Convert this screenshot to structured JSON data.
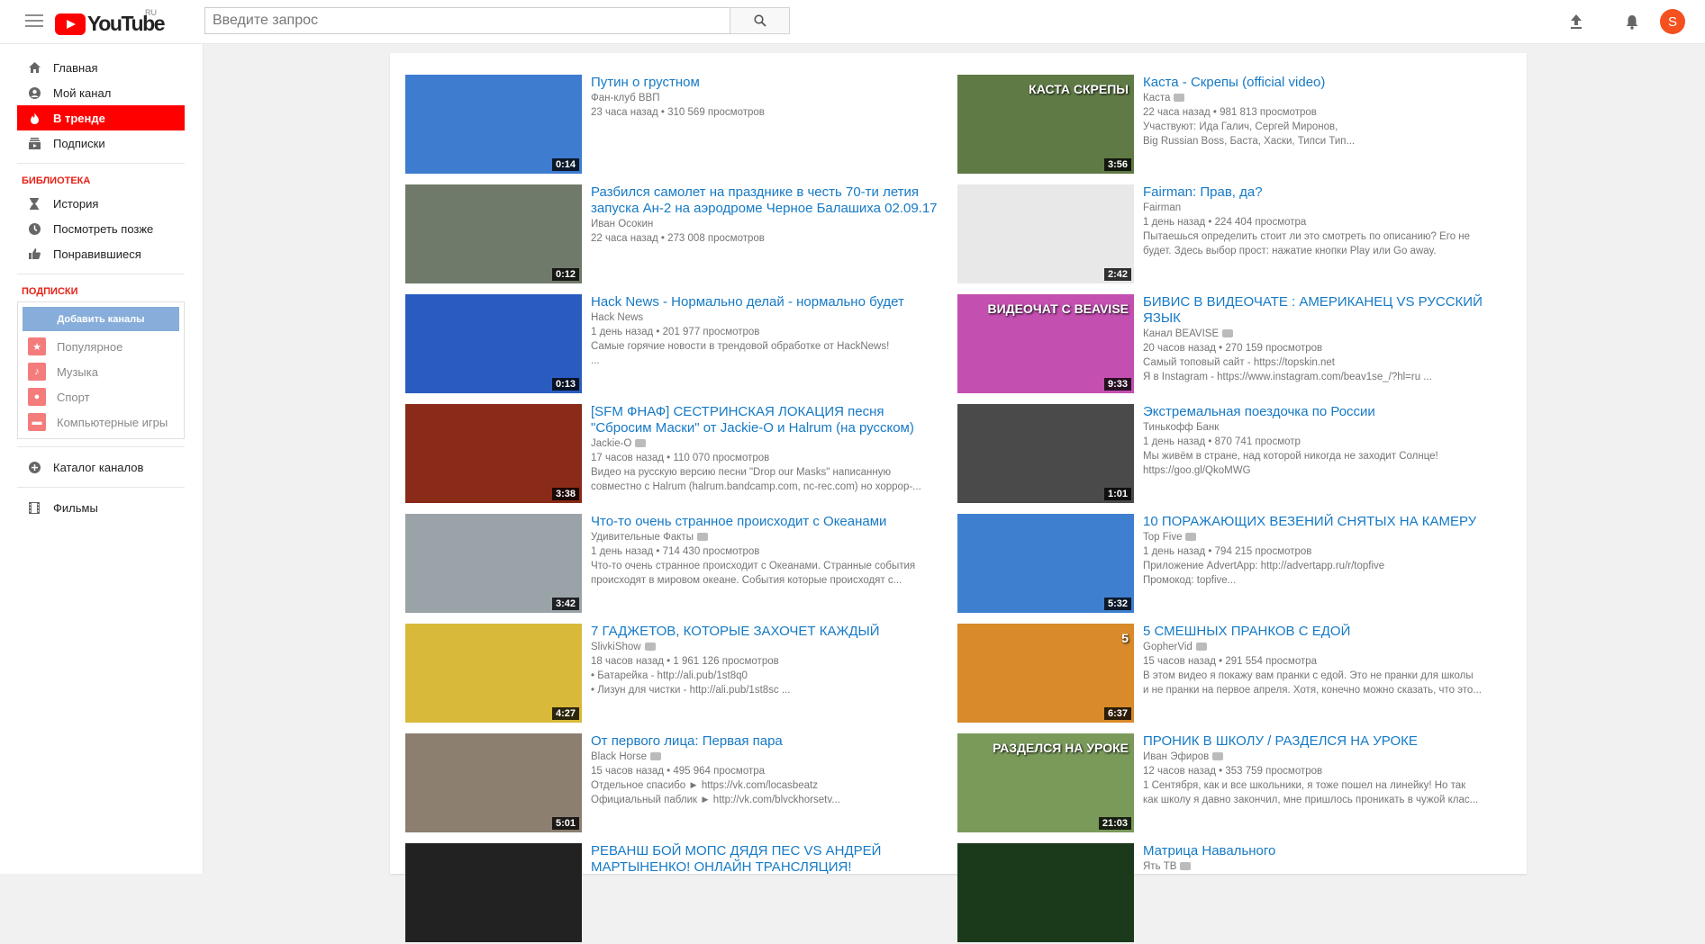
{
  "header": {
    "logo_text": "YouTube",
    "logo_region": "RU",
    "search_placeholder": "Введите запрос",
    "avatar_letter": "S"
  },
  "sidebar": {
    "main_items": [
      {
        "label": "Главная",
        "icon": "home-icon"
      },
      {
        "label": "Мой канал",
        "icon": "user-icon"
      },
      {
        "label": "В тренде",
        "icon": "flame-icon"
      },
      {
        "label": "Подписки",
        "icon": "subscriptions-icon"
      }
    ],
    "library_title": "Библиотека",
    "library_items": [
      {
        "label": "История",
        "icon": "hourglass-icon"
      },
      {
        "label": "Посмотреть позже",
        "icon": "clock-icon"
      },
      {
        "label": "Понравившиеся",
        "icon": "thumbs-up-icon"
      }
    ],
    "subs_title": "Подписки",
    "add_channels": "Добавить каналы",
    "sub_items": [
      {
        "label": "Популярное",
        "icon": "star-icon"
      },
      {
        "label": "Музыка",
        "icon": "music-icon"
      },
      {
        "label": "Спорт",
        "icon": "ball-icon"
      },
      {
        "label": "Компьютерные игры",
        "icon": "gamepad-icon"
      }
    ],
    "catalog": "Каталог каналов",
    "films": "Фильмы"
  },
  "videos_left": [
    {
      "title": "Путин о грустном",
      "channel": "Фан-клуб ВВП",
      "verified": false,
      "age": "23 часа назад",
      "views": "310 569 просмотров",
      "duration": "0:14",
      "desc1": "",
      "desc2": "",
      "thumb": "#3d7ccf"
    },
    {
      "title": "Разбился самолет на празднике в честь 70-ти летия запуска Ан-2 на аэродроме Черное Балашиха 02.09.17",
      "channel": "Иван Осокин",
      "verified": false,
      "age": "22 часа назад",
      "views": "273 008 просмотров",
      "duration": "0:12",
      "desc1": "",
      "desc2": "",
      "thumb": "#6f7a6a"
    },
    {
      "title": "Hack News - Нормально делай - нормально будет",
      "channel": "Hack News",
      "verified": false,
      "age": "1 день назад",
      "views": "201 977 просмотров",
      "duration": "0:13",
      "desc1": "Самые горячие новости в трендовой обработке от HackNews!",
      "desc2": "...",
      "thumb": "#2a5cbf"
    },
    {
      "title": "[SFM ФНАФ] СЕСТРИНСКАЯ ЛОКАЦИЯ песня \"Сбросим Маски\" от Jackie-O и Halrum (на русском)",
      "channel": "Jackie-O",
      "verified": true,
      "age": "17 часов назад",
      "views": "110 070 просмотров",
      "duration": "3:38",
      "desc1": "Видео на русскую версию песни \"Drop our Masks\" написанную",
      "desc2": "совместно с Halrum (halrum.bandcamp.com, nc-rec.com) но хоррор-...",
      "thumb": "#8a2a18"
    },
    {
      "title": "Что-то очень странное происходит с Океанами",
      "channel": "Удивительные Факты",
      "verified": true,
      "age": "1 день назад",
      "views": "714 430 просмотров",
      "duration": "3:42",
      "desc1": "Что-то очень странное происходит с Океанами. Странные события",
      "desc2": "происходят в мировом океане. События которые происходят с...",
      "thumb": "#9aa3a8"
    },
    {
      "title": "7 ГАДЖЕТОВ, КОТОРЫЕ ЗАХОЧЕТ КАЖДЫЙ",
      "channel": "SlivkiShow",
      "verified": true,
      "age": "18 часов назад",
      "views": "1 961 126 просмотров",
      "duration": "4:27",
      "desc1": "• Батарейка - http://ali.pub/1st8q0",
      "desc2": "• Лизун для чистки - http://ali.pub/1st8sc ...",
      "thumb": "#d9b93a"
    },
    {
      "title": "От первого лица: Первая пара",
      "channel": "Black Horse",
      "verified": true,
      "age": "15 часов назад",
      "views": "495 964 просмотра",
      "duration": "5:01",
      "desc1": "Отдельное спасибо ► https://vk.com/locasbeatz",
      "desc2": "Официальный паблик ► http://vk.com/blvckhorsetv...",
      "thumb": "#8c7f70"
    },
    {
      "title": "РЕВАНШ БОЙ МОПС ДЯДЯ ПЕС VS АНДРЕЙ МАРТЫНЕНКО! ОНЛАЙН ТРАНСЛЯЦИЯ!",
      "channel": "",
      "verified": false,
      "age": "",
      "views": "",
      "duration": "",
      "desc1": "",
      "desc2": "",
      "thumb": "#222222"
    }
  ],
  "videos_right": [
    {
      "title": "Каста - Скрепы (official video)",
      "channel": "Каста",
      "verified": true,
      "age": "22 часа назад",
      "views": "981 813 просмотров",
      "duration": "3:56",
      "desc1": "Участвуют: Ида Галич, Сергей Миронов,",
      "desc2": "Big Russian Boss, Баста, Хаски, Типси Тип...",
      "thumb": "#5f7a45",
      "overlay": "КАСТА СКРЕПЫ"
    },
    {
      "title": "Fairman: Прав, да?",
      "channel": "Fairman",
      "verified": false,
      "age": "1 день назад",
      "views": "224 404 просмотра",
      "duration": "2:42",
      "desc1": "Пытаешься определить стоит ли это смотреть по описанию? Его не",
      "desc2": "будет. Здесь выбор прост: нажатие кнопки Play или Go away.",
      "thumb": "#e8e8e8",
      "overlay": ""
    },
    {
      "title": "БИВИС В ВИДЕОЧАТЕ : АМЕРИКАНЕЦ VS РУССКИЙ ЯЗЫК",
      "channel": "Канал BEAVISE",
      "verified": true,
      "age": "20 часов назад",
      "views": "270 159 просмотров",
      "duration": "9:33",
      "desc1": "Самый топовый сайт - https://topskin.net",
      "desc2": "Я в Instagram - https://www.instagram.com/beav1se_/?hl=ru ...",
      "thumb": "#c34fb0",
      "overlay": "ВИДЕОЧАТ С BEAVISE"
    },
    {
      "title": "Экстремальная поездочка по России",
      "channel": "Тинькофф Банк",
      "verified": false,
      "age": "1 день назад",
      "views": "870 741 просмотр",
      "duration": "1:01",
      "desc1": "Мы живём в стране, над которой никогда не заходит Солнце!",
      "desc2": "https://goo.gl/QkoMWG",
      "thumb": "#4a4a4a",
      "overlay": ""
    },
    {
      "title": "10 ПОРАЖАЮЩИХ ВЕЗЕНИЙ СНЯТЫХ НА КАМЕРУ",
      "channel": "Top Five",
      "verified": true,
      "age": "1 день назад",
      "views": "794 215 просмотров",
      "duration": "5:32",
      "desc1": "Приложение AdvertApp: http://advertapp.ru/r/topfive",
      "desc2": "Промокод: topfive...",
      "thumb": "#3f7fcf",
      "overlay": ""
    },
    {
      "title": "5 СМЕШНЫХ ПРАНКОВ С ЕДОЙ",
      "channel": "GopherVid",
      "verified": true,
      "age": "15 часов назад",
      "views": "291 554 просмотра",
      "duration": "6:37",
      "desc1": "В этом видео я покажу вам пранки с едой. Это не пранки для школы",
      "desc2": "и не пранки на первое апреля. Хотя, конечно можно сказать, что это...",
      "thumb": "#d98a2a",
      "overlay": "5"
    },
    {
      "title": "ПРОНИК В ШКОЛУ / РАЗДЕЛСЯ НА УРОКЕ",
      "channel": "Иван Эфиров",
      "verified": true,
      "age": "12 часов назад",
      "views": "353 759 просмотров",
      "duration": "21:03",
      "desc1": "1 Сентября, как и все школьники, я тоже пошел на линейку! Но так",
      "desc2": "как школу я давно закончил, мне пришлось проникать в чужой клас...",
      "thumb": "#7a9a5a",
      "overlay": "РАЗДЕЛСЯ НА УРОКЕ"
    },
    {
      "title": "Матрица Навального",
      "channel": "Ять ТВ",
      "verified": true,
      "age": "",
      "views": "",
      "duration": "",
      "desc1": "",
      "desc2": "",
      "thumb": "#1b3a1b",
      "overlay": ""
    }
  ],
  "colors": {
    "accent": "#ff0000",
    "link": "#167ac6",
    "meta": "#767676",
    "section": "#e62117"
  }
}
